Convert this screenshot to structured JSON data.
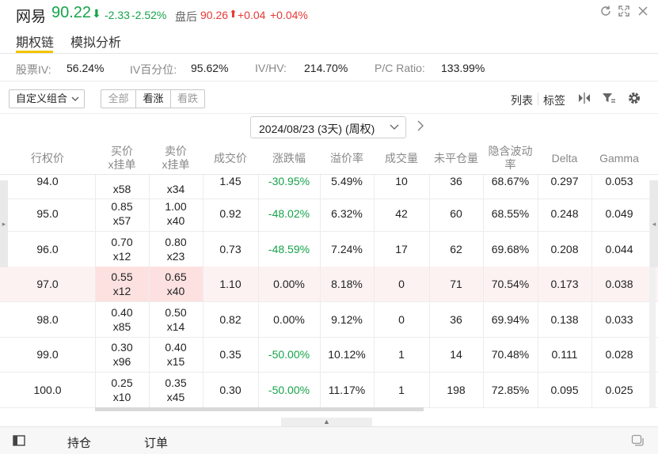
{
  "header": {
    "name": "网易",
    "price": "90.22",
    "price_arrow": "⬇",
    "change": "-2.33",
    "change_pct": "-2.52%",
    "after_hours_label": "盘后",
    "after_hours_price": "90.26",
    "after_hours_arrow": "⬆",
    "after_hours_change": "+0.04",
    "after_hours_pct": "+0.04%",
    "icons": [
      "refresh-icon",
      "fullscreen-icon",
      "close-icon"
    ]
  },
  "tabs": [
    {
      "label": "期权链",
      "active": true
    },
    {
      "label": "模拟分析",
      "active": false
    }
  ],
  "stats": [
    {
      "label": "股票IV:",
      "value": "56.24%"
    },
    {
      "label": "IV百分位:",
      "value": "95.62%"
    },
    {
      "label": "IV/HV:",
      "value": "214.70%"
    },
    {
      "label": "P/C Ratio:",
      "value": "133.99%"
    }
  ],
  "toolbar": {
    "combo_label": "自定义组合",
    "filters": [
      "全部",
      "看涨",
      "看跌"
    ],
    "active_filter": "看涨",
    "list_label": "列表",
    "tag_label": "标签"
  },
  "expiry": {
    "label": "2024/08/23 (3天) (周权)"
  },
  "columns": [
    "行权价",
    "买价\nx挂单",
    "卖价\nx挂单",
    "成交价",
    "涨跌幅",
    "溢价率",
    "成交量",
    "未平仓量",
    "隐含波动率",
    "Delta",
    "Gamma"
  ],
  "rows": [
    {
      "strike": "94.0",
      "bid": "",
      "bid_size": "x58",
      "ask": "",
      "ask_size": "x34",
      "last": "1.45",
      "change": "-30.95%",
      "premium": "5.49%",
      "volume": "10",
      "oi": "36",
      "iv": "68.67%",
      "delta": "0.297",
      "gamma": "0.053",
      "partial": true
    },
    {
      "strike": "95.0",
      "bid": "0.85",
      "bid_size": "x57",
      "ask": "1.00",
      "ask_size": "x40",
      "last": "0.92",
      "change": "-48.02%",
      "premium": "6.32%",
      "volume": "42",
      "oi": "60",
      "iv": "68.55%",
      "delta": "0.248",
      "gamma": "0.049"
    },
    {
      "strike": "96.0",
      "bid": "0.70",
      "bid_size": "x12",
      "ask": "0.80",
      "ask_size": "x23",
      "last": "0.73",
      "change": "-48.59%",
      "premium": "7.24%",
      "volume": "17",
      "oi": "62",
      "iv": "69.68%",
      "delta": "0.208",
      "gamma": "0.044"
    },
    {
      "strike": "97.0",
      "bid": "0.55",
      "bid_size": "x12",
      "ask": "0.65",
      "ask_size": "x40",
      "last": "1.10",
      "change": "0.00%",
      "premium": "8.18%",
      "volume": "0",
      "oi": "71",
      "iv": "70.54%",
      "delta": "0.173",
      "gamma": "0.038",
      "highlight": true
    },
    {
      "strike": "98.0",
      "bid": "0.40",
      "bid_size": "x85",
      "ask": "0.50",
      "ask_size": "x14",
      "last": "0.82",
      "change": "0.00%",
      "premium": "9.12%",
      "volume": "0",
      "oi": "36",
      "iv": "69.94%",
      "delta": "0.138",
      "gamma": "0.033"
    },
    {
      "strike": "99.0",
      "bid": "0.30",
      "bid_size": "x96",
      "ask": "0.40",
      "ask_size": "x15",
      "last": "0.35",
      "change": "-50.00%",
      "premium": "10.12%",
      "volume": "1",
      "oi": "14",
      "iv": "70.48%",
      "delta": "0.111",
      "gamma": "0.028"
    },
    {
      "strike": "100.0",
      "bid": "0.25",
      "bid_size": "x10",
      "ask": "0.35",
      "ask_size": "x45",
      "last": "0.30",
      "change": "-50.00%",
      "premium": "11.17%",
      "volume": "1",
      "oi": "198",
      "iv": "72.85%",
      "delta": "0.095",
      "gamma": "0.025"
    }
  ],
  "footer": {
    "positions_label": "持仓",
    "orders_label": "订单"
  },
  "colors": {
    "up": "#e53935",
    "down": "#16a34a",
    "accent": "#f2c400",
    "atm_row": "#fde1e1"
  }
}
